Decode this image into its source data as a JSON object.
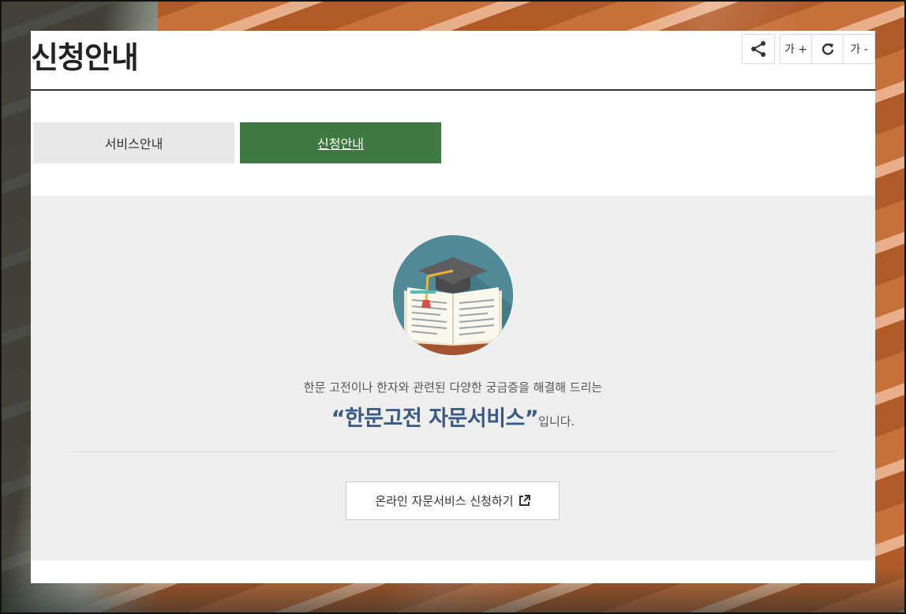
{
  "page": {
    "title": "신청안내"
  },
  "toolbar": {
    "share_icon": "share-icon",
    "font_increase_label": "가 +",
    "reset_icon": "refresh-icon",
    "font_decrease_label": "가 -"
  },
  "tabs": [
    {
      "label": "서비스안내",
      "active": false
    },
    {
      "label": "신청안내",
      "active": true
    }
  ],
  "main": {
    "illustration": "graduation-cap-book-illustration",
    "intro_text": "한문 고전이나 한자와 관련된 다양한 궁금증을 해결해 드리는",
    "headline": "“한문고전 자문서비스”",
    "headline_suffix": "입니다.",
    "apply_button_label": "온라인 자문서비스 신청하기",
    "apply_button_icon": "external-link-icon"
  },
  "colors": {
    "accent_green": "#3e7a40",
    "headline_blue": "#3a5a86",
    "content_bg": "#efefef"
  }
}
